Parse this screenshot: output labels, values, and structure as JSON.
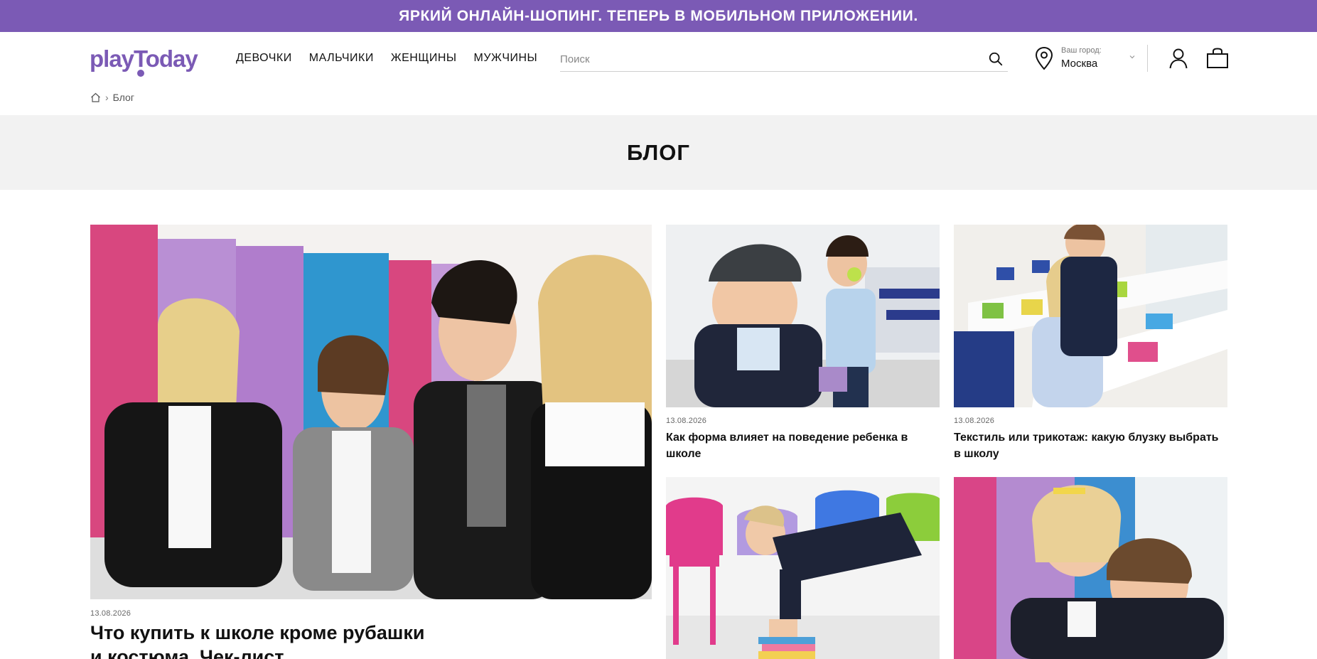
{
  "promo": {
    "text": "ЯРКИЙ ОНЛАЙН-ШОПИНГ. ТЕПЕРЬ В МОБИЛЬНОМ ПРИЛОЖЕНИИ."
  },
  "header": {
    "logo": "playToday",
    "nav": [
      "ДЕВОЧКИ",
      "МАЛЬЧИКИ",
      "ЖЕНЩИНЫ",
      "МУЖЧИНЫ"
    ],
    "search": {
      "placeholder": "Поиск",
      "value": ""
    },
    "city": {
      "caption": "Ваш город:",
      "name": "Москва"
    }
  },
  "breadcrumb": {
    "current": "Блог"
  },
  "page": {
    "title": "БЛОГ"
  },
  "articles": [
    {
      "date": "13.08.2026",
      "title": "Что купить к школе кроме рубашки и костюма. Чек-лист"
    },
    {
      "date": "13.08.2026",
      "title": "Как форма влияет на поведение ребенка в школе"
    },
    {
      "date": "13.08.2026",
      "title": "Текстиль или трикотаж: какую блузку выбрать в школу"
    },
    {
      "date": "",
      "title": ""
    },
    {
      "date": "",
      "title": ""
    }
  ],
  "colors": {
    "brand": "#7b5ab5",
    "title_band": "#f2f2f2"
  }
}
